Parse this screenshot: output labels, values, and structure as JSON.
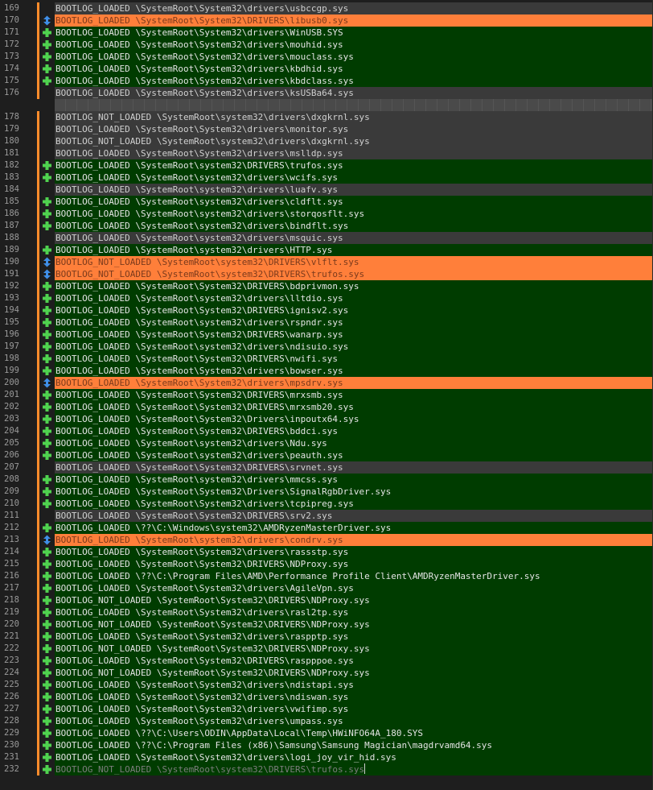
{
  "colors": {
    "same": "#3a3a3a",
    "added": "#003c00",
    "removed": "#ff7f3a",
    "marker_add": "#4fd24f",
    "marker_move": "#3f8fe8",
    "change_bar": "#ff8c2b"
  },
  "icons": {
    "added": "plus-icon",
    "removed": "up-down-arrow-icon"
  },
  "lines": [
    {
      "num": "169",
      "type": "same",
      "marker": "",
      "text": "BOOTLOG_LOADED \\SystemRoot\\System32\\drivers\\usbccgp.sys"
    },
    {
      "num": "170",
      "type": "removed",
      "marker": "move",
      "text": "BOOTLOG_LOADED \\SystemRoot\\System32\\DRIVERS\\libusb0.sys"
    },
    {
      "num": "171",
      "type": "added",
      "marker": "add",
      "text": "BOOTLOG_LOADED \\SystemRoot\\System32\\drivers\\WinUSB.SYS"
    },
    {
      "num": "172",
      "type": "added",
      "marker": "add",
      "text": "BOOTLOG_LOADED \\SystemRoot\\System32\\drivers\\mouhid.sys"
    },
    {
      "num": "173",
      "type": "added",
      "marker": "add",
      "text": "BOOTLOG_LOADED \\SystemRoot\\System32\\drivers\\mouclass.sys"
    },
    {
      "num": "174",
      "type": "added",
      "marker": "add",
      "text": "BOOTLOG_LOADED \\SystemRoot\\System32\\drivers\\kbdhid.sys"
    },
    {
      "num": "175",
      "type": "added",
      "marker": "add",
      "text": "BOOTLOG_LOADED \\SystemRoot\\System32\\drivers\\kbdclass.sys"
    },
    {
      "num": "176",
      "type": "same",
      "marker": "",
      "text": "BOOTLOG_LOADED \\SystemRoot\\System32\\drivers\\ksUSBa64.sys"
    },
    {
      "num": "",
      "type": "blank",
      "marker": "",
      "text": ""
    },
    {
      "num": "178",
      "type": "same",
      "marker": "",
      "text": "BOOTLOG_NOT_LOADED \\SystemRoot\\system32\\drivers\\dxgkrnl.sys"
    },
    {
      "num": "179",
      "type": "same",
      "marker": "",
      "text": "BOOTLOG_LOADED \\SystemRoot\\System32\\drivers\\monitor.sys"
    },
    {
      "num": "180",
      "type": "same",
      "marker": "",
      "text": "BOOTLOG_NOT_LOADED \\SystemRoot\\system32\\drivers\\dxgkrnl.sys"
    },
    {
      "num": "181",
      "type": "same",
      "marker": "",
      "text": "BOOTLOG_LOADED \\SystemRoot\\System32\\drivers\\mslldp.sys"
    },
    {
      "num": "182",
      "type": "added",
      "marker": "add",
      "text": "BOOTLOG_LOADED \\SystemRoot\\system32\\DRIVERS\\trufos.sys"
    },
    {
      "num": "183",
      "type": "added",
      "marker": "add",
      "text": "BOOTLOG_LOADED \\SystemRoot\\system32\\drivers\\wcifs.sys"
    },
    {
      "num": "184",
      "type": "same",
      "marker": "",
      "text": "BOOTLOG_LOADED \\SystemRoot\\system32\\drivers\\luafv.sys"
    },
    {
      "num": "185",
      "type": "added",
      "marker": "add",
      "text": "BOOTLOG_LOADED \\SystemRoot\\system32\\drivers\\cldflt.sys"
    },
    {
      "num": "186",
      "type": "added",
      "marker": "add",
      "text": "BOOTLOG_LOADED \\SystemRoot\\system32\\drivers\\storqosflt.sys"
    },
    {
      "num": "187",
      "type": "added",
      "marker": "add",
      "text": "BOOTLOG_LOADED \\SystemRoot\\system32\\drivers\\bindflt.sys"
    },
    {
      "num": "188",
      "type": "same",
      "marker": "",
      "text": "BOOTLOG_LOADED \\SystemRoot\\system32\\drivers\\msquic.sys"
    },
    {
      "num": "189",
      "type": "added",
      "marker": "add",
      "text": "BOOTLOG_LOADED \\SystemRoot\\system32\\drivers\\HTTP.sys"
    },
    {
      "num": "190",
      "type": "removed",
      "marker": "move",
      "text": "BOOTLOG_NOT_LOADED \\SystemRoot\\system32\\DRIVERS\\vlflt.sys"
    },
    {
      "num": "191",
      "type": "removed",
      "marker": "move",
      "text": "BOOTLOG_NOT_LOADED \\SystemRoot\\system32\\DRIVERS\\trufos.sys"
    },
    {
      "num": "192",
      "type": "added",
      "marker": "add",
      "text": "BOOTLOG_LOADED \\SystemRoot\\System32\\DRIVERS\\bdprivmon.sys"
    },
    {
      "num": "193",
      "type": "added",
      "marker": "add",
      "text": "BOOTLOG_LOADED \\SystemRoot\\system32\\drivers\\lltdio.sys"
    },
    {
      "num": "194",
      "type": "added",
      "marker": "add",
      "text": "BOOTLOG_LOADED \\SystemRoot\\System32\\DRIVERS\\ignisv2.sys"
    },
    {
      "num": "195",
      "type": "added",
      "marker": "add",
      "text": "BOOTLOG_LOADED \\SystemRoot\\system32\\drivers\\rspndr.sys"
    },
    {
      "num": "196",
      "type": "added",
      "marker": "add",
      "text": "BOOTLOG_LOADED \\SystemRoot\\System32\\DRIVERS\\wanarp.sys"
    },
    {
      "num": "197",
      "type": "added",
      "marker": "add",
      "text": "BOOTLOG_LOADED \\SystemRoot\\system32\\drivers\\ndisuio.sys"
    },
    {
      "num": "198",
      "type": "added",
      "marker": "add",
      "text": "BOOTLOG_LOADED \\SystemRoot\\System32\\DRIVERS\\nwifi.sys"
    },
    {
      "num": "199",
      "type": "added",
      "marker": "add",
      "text": "BOOTLOG_LOADED \\SystemRoot\\System32\\drivers\\bowser.sys"
    },
    {
      "num": "200",
      "type": "removed",
      "marker": "move",
      "text": "BOOTLOG_LOADED \\SystemRoot\\System32\\drivers\\mpsdrv.sys"
    },
    {
      "num": "201",
      "type": "added",
      "marker": "add",
      "text": "BOOTLOG_LOADED \\SystemRoot\\System32\\DRIVERS\\mrxsmb.sys"
    },
    {
      "num": "202",
      "type": "added",
      "marker": "add",
      "text": "BOOTLOG_LOADED \\SystemRoot\\System32\\DRIVERS\\mrxsmb20.sys"
    },
    {
      "num": "203",
      "type": "added",
      "marker": "add",
      "text": "BOOTLOG_LOADED \\SystemRoot\\System32\\Drivers\\inpoutx64.sys"
    },
    {
      "num": "204",
      "type": "added",
      "marker": "add",
      "text": "BOOTLOG_LOADED \\SystemRoot\\System32\\DRIVERS\\bddci.sys"
    },
    {
      "num": "205",
      "type": "added",
      "marker": "add",
      "text": "BOOTLOG_LOADED \\SystemRoot\\system32\\drivers\\Ndu.sys"
    },
    {
      "num": "206",
      "type": "added",
      "marker": "add",
      "text": "BOOTLOG_LOADED \\SystemRoot\\system32\\drivers\\peauth.sys"
    },
    {
      "num": "207",
      "type": "same",
      "marker": "",
      "text": "BOOTLOG_LOADED \\SystemRoot\\System32\\DRIVERS\\srvnet.sys"
    },
    {
      "num": "208",
      "type": "added",
      "marker": "add",
      "text": "BOOTLOG_LOADED \\SystemRoot\\system32\\drivers\\mmcss.sys"
    },
    {
      "num": "209",
      "type": "added",
      "marker": "add",
      "text": "BOOTLOG_LOADED \\SystemRoot\\System32\\Drivers\\SignalRgbDriver.sys"
    },
    {
      "num": "210",
      "type": "added",
      "marker": "add",
      "text": "BOOTLOG_LOADED \\SystemRoot\\System32\\drivers\\tcpipreg.sys"
    },
    {
      "num": "211",
      "type": "same",
      "marker": "",
      "text": "BOOTLOG_LOADED \\SystemRoot\\System32\\DRIVERS\\srv2.sys"
    },
    {
      "num": "212",
      "type": "added",
      "marker": "add",
      "text": "BOOTLOG_LOADED \\??\\C:\\Windows\\system32\\AMDRyzenMasterDriver.sys"
    },
    {
      "num": "213",
      "type": "removed",
      "marker": "move",
      "text": "BOOTLOG_LOADED \\SystemRoot\\system32\\drivers\\condrv.sys"
    },
    {
      "num": "214",
      "type": "added",
      "marker": "add",
      "text": "BOOTLOG_LOADED \\SystemRoot\\System32\\drivers\\rassstp.sys"
    },
    {
      "num": "215",
      "type": "added",
      "marker": "add",
      "text": "BOOTLOG_LOADED \\SystemRoot\\System32\\DRIVERS\\NDProxy.sys"
    },
    {
      "num": "216",
      "type": "added",
      "marker": "add",
      "text": "BOOTLOG_LOADED \\??\\C:\\Program Files\\AMD\\Performance Profile Client\\AMDRyzenMasterDriver.sys"
    },
    {
      "num": "217",
      "type": "added",
      "marker": "add",
      "text": "BOOTLOG_LOADED \\SystemRoot\\System32\\drivers\\AgileVpn.sys"
    },
    {
      "num": "218",
      "type": "added",
      "marker": "add",
      "text": "BOOTLOG_NOT_LOADED \\SystemRoot\\System32\\DRIVERS\\NDProxy.sys"
    },
    {
      "num": "219",
      "type": "added",
      "marker": "add",
      "text": "BOOTLOG_LOADED \\SystemRoot\\System32\\drivers\\rasl2tp.sys"
    },
    {
      "num": "220",
      "type": "added",
      "marker": "add",
      "text": "BOOTLOG_NOT_LOADED \\SystemRoot\\System32\\DRIVERS\\NDProxy.sys"
    },
    {
      "num": "221",
      "type": "added",
      "marker": "add",
      "text": "BOOTLOG_LOADED \\SystemRoot\\System32\\drivers\\raspptp.sys"
    },
    {
      "num": "222",
      "type": "added",
      "marker": "add",
      "text": "BOOTLOG_NOT_LOADED \\SystemRoot\\System32\\DRIVERS\\NDProxy.sys"
    },
    {
      "num": "223",
      "type": "added",
      "marker": "add",
      "text": "BOOTLOG_LOADED \\SystemRoot\\System32\\DRIVERS\\raspppoe.sys"
    },
    {
      "num": "224",
      "type": "added",
      "marker": "add",
      "text": "BOOTLOG_NOT_LOADED \\SystemRoot\\System32\\DRIVERS\\NDProxy.sys"
    },
    {
      "num": "225",
      "type": "added",
      "marker": "add",
      "text": "BOOTLOG_LOADED \\SystemRoot\\System32\\drivers\\ndistapi.sys"
    },
    {
      "num": "226",
      "type": "added",
      "marker": "add",
      "text": "BOOTLOG_LOADED \\SystemRoot\\System32\\drivers\\ndiswan.sys"
    },
    {
      "num": "227",
      "type": "added",
      "marker": "add",
      "text": "BOOTLOG_LOADED \\SystemRoot\\System32\\drivers\\vwifimp.sys"
    },
    {
      "num": "228",
      "type": "added",
      "marker": "add",
      "text": "BOOTLOG_LOADED \\SystemRoot\\System32\\drivers\\umpass.sys"
    },
    {
      "num": "229",
      "type": "added",
      "marker": "add",
      "text": "BOOTLOG_LOADED \\??\\C:\\Users\\ODIN\\AppData\\Local\\Temp\\HWiNFO64A_180.SYS"
    },
    {
      "num": "230",
      "type": "added",
      "marker": "add",
      "text": "BOOTLOG_LOADED \\??\\C:\\Program Files (x86)\\Samsung\\Samsung Magician\\magdrvamd64.sys"
    },
    {
      "num": "231",
      "type": "added",
      "marker": "add",
      "text": "BOOTLOG_LOADED \\SystemRoot\\System32\\drivers\\logi_joy_vir_hid.sys"
    },
    {
      "num": "232",
      "type": "last",
      "marker": "add",
      "text": "BOOTLOG_NOT_LOADED \\SystemRoot\\system32\\DRIVERS\\trufos.sys"
    }
  ]
}
